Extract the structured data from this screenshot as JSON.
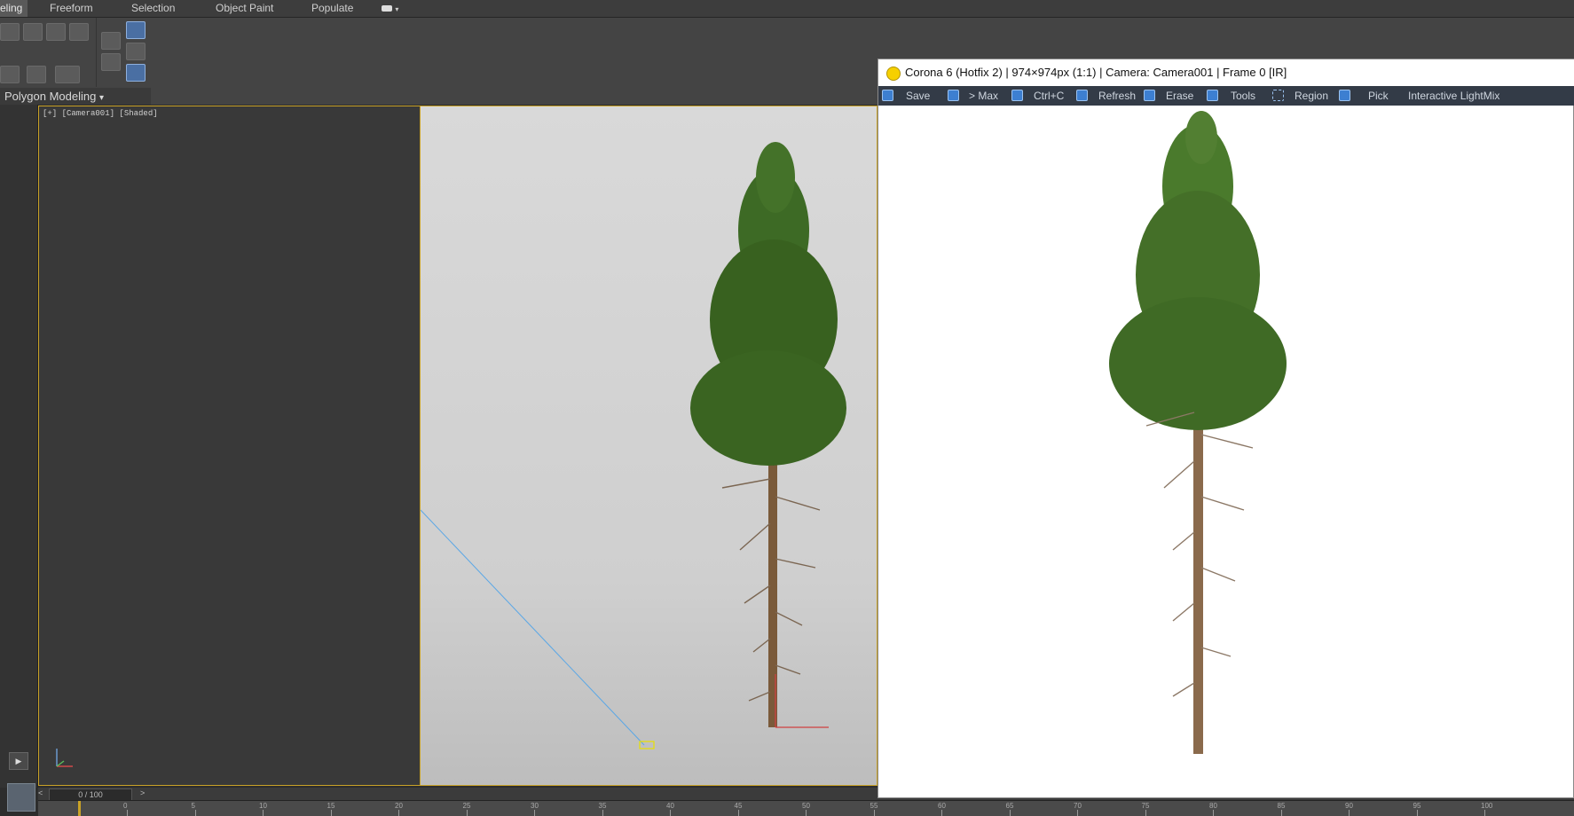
{
  "ribbon": {
    "tabs": [
      {
        "label": "eling",
        "active": true
      },
      {
        "label": "Freeform"
      },
      {
        "label": "Selection"
      },
      {
        "label": "Object Paint"
      },
      {
        "label": "Populate"
      }
    ],
    "panel_label": "Polygon Modeling"
  },
  "viewport": {
    "label": "[+] [Camera001] [Shaded]"
  },
  "timeline": {
    "slider_text": "0 / 100",
    "ruler_ticks": [
      "0",
      "5",
      "10",
      "15",
      "20",
      "25",
      "30",
      "35",
      "40",
      "45",
      "50",
      "55",
      "60",
      "65",
      "70",
      "75",
      "80",
      "85",
      "90",
      "95",
      "100"
    ]
  },
  "corona": {
    "title": "Corona 6 (Hotfix 2) | 974×974px (1:1) | Camera: Camera001 | Frame 0 [IR]",
    "toolbar": {
      "save": "Save",
      "to_max": "> Max",
      "copy": "Ctrl+C",
      "refresh": "Refresh",
      "erase": "Erase",
      "tools": "Tools",
      "region": "Region",
      "pick": "Pick",
      "lightmix": "Interactive LightMix"
    }
  },
  "colors": {
    "viewport_border": "#c9a227",
    "corona_toolbar": "#333b47",
    "accent_blue": "#3d7fd1"
  }
}
